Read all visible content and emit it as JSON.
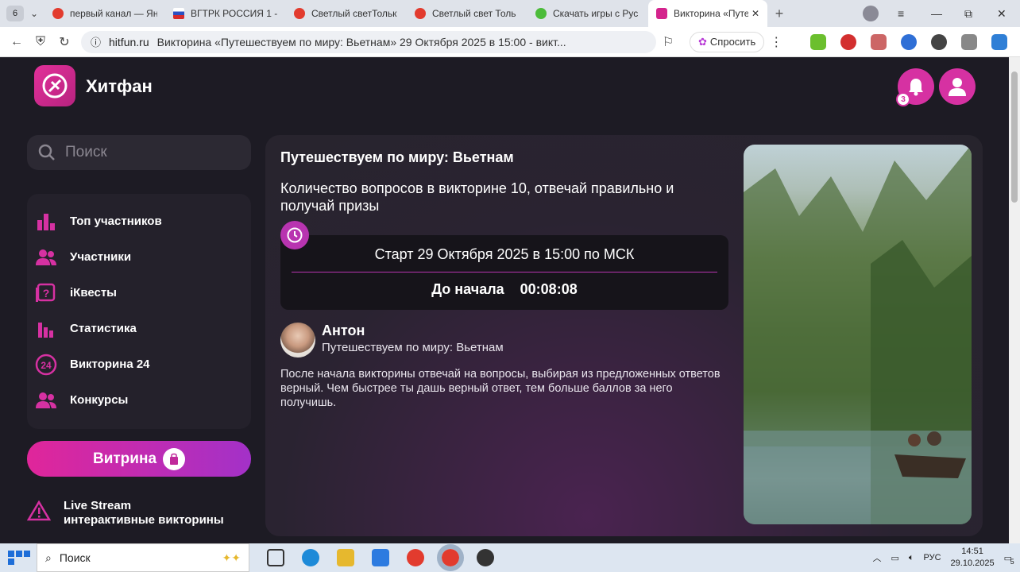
{
  "browser": {
    "tab_count": "6",
    "tabs": [
      {
        "title": "первый канал — Ян",
        "color": "#e23b2e"
      },
      {
        "title": "ВГТРК РОССИЯ 1 -",
        "color": "#2b50c2"
      },
      {
        "title": "Светлый светТольк",
        "color": "#e23b2e"
      },
      {
        "title": "Светлый свет Толь",
        "color": "#e23b2e"
      },
      {
        "title": "Скачать игры с Рус",
        "color": "#4cbc3a"
      },
      {
        "title": "Викторина «Путе",
        "color": "#d4248d"
      }
    ],
    "domain": "hitfun.ru",
    "page_title": "Викторина «Путешествуем по миру: Вьетнам» 29 Октября 2025 в 15:00 - викт...",
    "ask_label": "Спросить"
  },
  "site": {
    "logo_text": "Хитфан",
    "notifications_count": "3",
    "search_placeholder": "Поиск",
    "menu": [
      {
        "label": "Топ участников",
        "icon": "bar-chart-icon"
      },
      {
        "label": "Участники",
        "icon": "users-icon"
      },
      {
        "label": "iКвесты",
        "icon": "question-icon"
      },
      {
        "label": "Статистика",
        "icon": "stats-icon"
      },
      {
        "label": "Викторина 24",
        "icon": "clock24-icon"
      },
      {
        "label": "Конкурсы",
        "icon": "contest-icon"
      }
    ],
    "vitrina_label": "Витрина",
    "live_line1": "Live Stream",
    "live_line2": "интерактивные викторины"
  },
  "quiz": {
    "title": "Путешествуем по миру: Вьетнам",
    "description": "Количество вопросов в викторине 10, отвечай правильно и получай призы",
    "start": "Старт 29 Октября 2025 в 15:00 по МСК",
    "countdown_label": "До начала",
    "countdown_value": "00:08:08",
    "author_name": "Антон",
    "author_sub": "Путешествуем по миру: Вьетнам",
    "rules": "После начала викторины отвечай на вопросы, выбирая из предложенных ответов верный. Чем быстрее ты дашь верный ответ, тем больше баллов за него получишь."
  },
  "taskbar": {
    "search_label": "Поиск",
    "lang": "РУС",
    "time": "14:51",
    "date": "29.10.2025",
    "notif": "5"
  },
  "colors": {
    "accent": "#d631a2",
    "background": "#1d1b24"
  }
}
